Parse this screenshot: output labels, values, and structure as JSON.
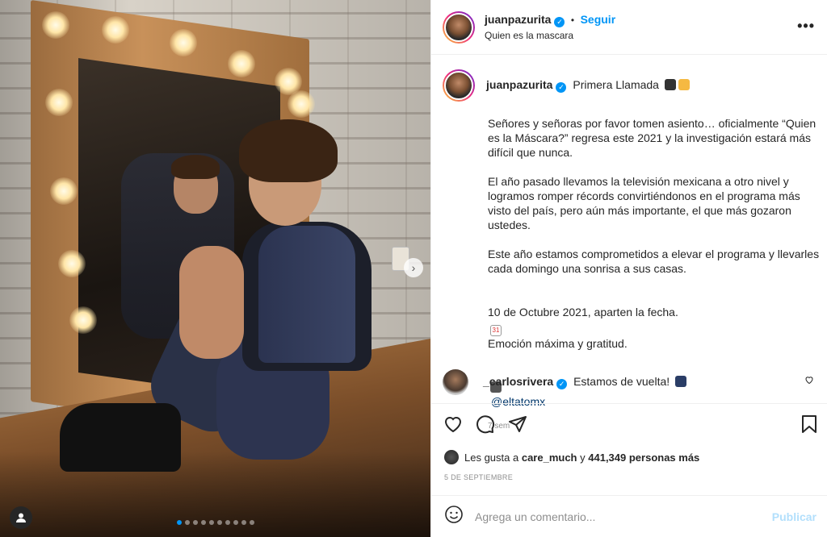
{
  "post": {
    "username": "juanpazurita",
    "follow_label": "Seguir",
    "separator": "•",
    "location": "Quien es la mascara",
    "more_label": "•••",
    "caption_title": "Primera Llamada",
    "caption_paragraphs": [
      "Señores y señoras por favor tomen asiento… oficialmente “Quien es la Máscara?” regresa este 2021 y la investigación estará más difícil que nunca.",
      "El año pasado llevamos la televisión mexicana a otro nivel y logramos romper récords convirtiéndonos en el programa más visto del país, pero aún más importante, el que más gozaron ustedes.",
      "Este año estamos comprometidos a elevar el programa y llevarles cada domingo una sonrisa a sus casas.",
      "10 de Octubre 2021, aparten la fecha.",
      "Emoción máxima y gratitud."
    ],
    "photo_credit": "@eltatomx",
    "time_ago": "7 sem",
    "comment": {
      "username": "_carlosrivera",
      "text": "Estamos de vuelta!"
    },
    "likes": {
      "prefix": "Les gusta a",
      "user": "care_much",
      "conj": "y",
      "count": "441,349 personas más"
    },
    "date": "5 DE SEPTIEMBRE",
    "add_comment_placeholder": "Agrega un comentario...",
    "publish_label": "Publicar",
    "carousel": {
      "total": 10,
      "active": 1
    }
  },
  "colors": {
    "accent": "#0095f6",
    "publish_disabled": "#b2dffc",
    "text": "#262626",
    "muted": "#8e8e8e"
  },
  "icons": [
    "verified-icon",
    "more-icon",
    "heart-icon",
    "comment-icon",
    "share-icon",
    "bookmark-icon",
    "emoji-icon",
    "user-icon",
    "next-arrow-icon",
    "camera-icon",
    "calendar-icon"
  ]
}
